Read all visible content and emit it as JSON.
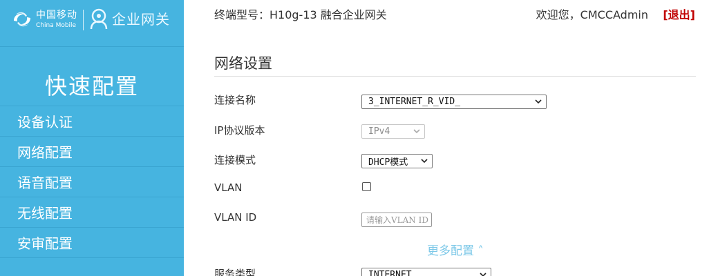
{
  "brand": {
    "cm_name": "中国移动",
    "cm_sub": "China Mobile",
    "enterprise_name": "企业网关"
  },
  "sidebar": {
    "title": "快速配置",
    "items": [
      {
        "label": "设备认证"
      },
      {
        "label": "网络配置"
      },
      {
        "label": "语音配置"
      },
      {
        "label": "无线配置"
      },
      {
        "label": "安审配置"
      }
    ]
  },
  "header": {
    "device_model": "终端型号：H10g-13 融合企业网关",
    "welcome": "欢迎您，CMCCAdmin",
    "logout": "[退出]"
  },
  "main": {
    "section_title": "网络设置",
    "connection_name": {
      "label": "连接名称",
      "value": "3_INTERNET_R_VID_"
    },
    "ip_version": {
      "label": "IP协议版本",
      "value": "IPv4"
    },
    "connection_mode": {
      "label": "连接模式",
      "value": "DHCP模式"
    },
    "vlan": {
      "label": "VLAN",
      "checked": false
    },
    "vlan_id": {
      "label": "VLAN ID",
      "placeholder": "请输入VLAN ID",
      "value": ""
    },
    "more_config": "更多配置 ˄",
    "service_type": {
      "label": "服务类型",
      "value": "INTERNET"
    }
  },
  "colors": {
    "sidebar_bg": "#46b4e0",
    "logout": "#c00000",
    "more_link": "#7cc8e8"
  }
}
